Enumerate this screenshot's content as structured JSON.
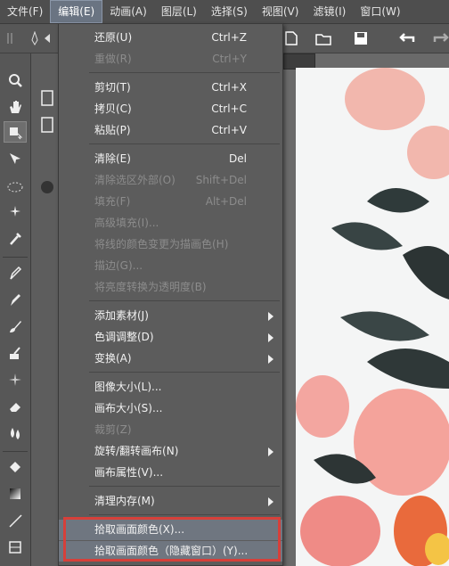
{
  "menubar": {
    "items": [
      "文件(F)",
      "编辑(E)",
      "动画(A)",
      "图层(L)",
      "选择(S)",
      "视图(V)",
      "滤镜(I)",
      "窗口(W)"
    ],
    "active_index": 1
  },
  "edit_menu": {
    "items": [
      {
        "label": "还原(U)",
        "shortcut": "Ctrl+Z",
        "enabled": true
      },
      {
        "label": "重做(R)",
        "shortcut": "Ctrl+Y",
        "enabled": false
      },
      {
        "label": "剪切(T)",
        "shortcut": "Ctrl+X",
        "enabled": true
      },
      {
        "label": "拷贝(C)",
        "shortcut": "Ctrl+C",
        "enabled": true
      },
      {
        "label": "粘贴(P)",
        "shortcut": "Ctrl+V",
        "enabled": true
      },
      {
        "label": "清除(E)",
        "shortcut": "Del",
        "enabled": true
      },
      {
        "label": "清除选区外部(O)",
        "shortcut": "Shift+Del",
        "enabled": false
      },
      {
        "label": "填充(F)",
        "shortcut": "Alt+Del",
        "enabled": false
      },
      {
        "label": "高级填充(I)...",
        "shortcut": "",
        "enabled": false
      },
      {
        "label": "将线的颜色变更为描画色(H)",
        "shortcut": "",
        "enabled": false
      },
      {
        "label": "描边(G)...",
        "shortcut": "",
        "enabled": false
      },
      {
        "label": "将亮度转换为透明度(B)",
        "shortcut": "",
        "enabled": false
      },
      {
        "label": "添加素材(J)",
        "shortcut": "",
        "enabled": true,
        "submenu": true
      },
      {
        "label": "色调调整(D)",
        "shortcut": "",
        "enabled": true,
        "submenu": true
      },
      {
        "label": "变换(A)",
        "shortcut": "",
        "enabled": true,
        "submenu": true
      },
      {
        "label": "图像大小(L)...",
        "shortcut": "",
        "enabled": true
      },
      {
        "label": "画布大小(S)...",
        "shortcut": "",
        "enabled": true
      },
      {
        "label": "裁剪(Z)",
        "shortcut": "",
        "enabled": false
      },
      {
        "label": "旋转/翻转画布(N)",
        "shortcut": "",
        "enabled": true,
        "submenu": true
      },
      {
        "label": "画布属性(V)...",
        "shortcut": "",
        "enabled": true
      },
      {
        "label": "清理内存(M)",
        "shortcut": "",
        "enabled": true,
        "submenu": true
      },
      {
        "label": "拾取画面颜色(X)...",
        "shortcut": "",
        "enabled": true
      },
      {
        "label": "拾取画面颜色（隐藏窗口）(Y)...",
        "shortcut": "",
        "enabled": true
      }
    ]
  },
  "colors": {
    "highlight_border": "#d6403a",
    "menu_bg": "#5c5c5c",
    "menubar_bg": "#4e4e4e"
  },
  "tools": [
    "zoom-icon",
    "hand-icon",
    "layer-move-icon",
    "sparkle-move-icon",
    "ellipse-select-icon",
    "magic-wand-icon",
    "eyedropper-icon",
    "pen-icon",
    "marker-icon",
    "brush-icon",
    "airbrush-icon",
    "decoration-icon",
    "eraser-icon",
    "blend-icon",
    "fill-icon",
    "gradient-icon",
    "line-icon",
    "frame-icon"
  ]
}
